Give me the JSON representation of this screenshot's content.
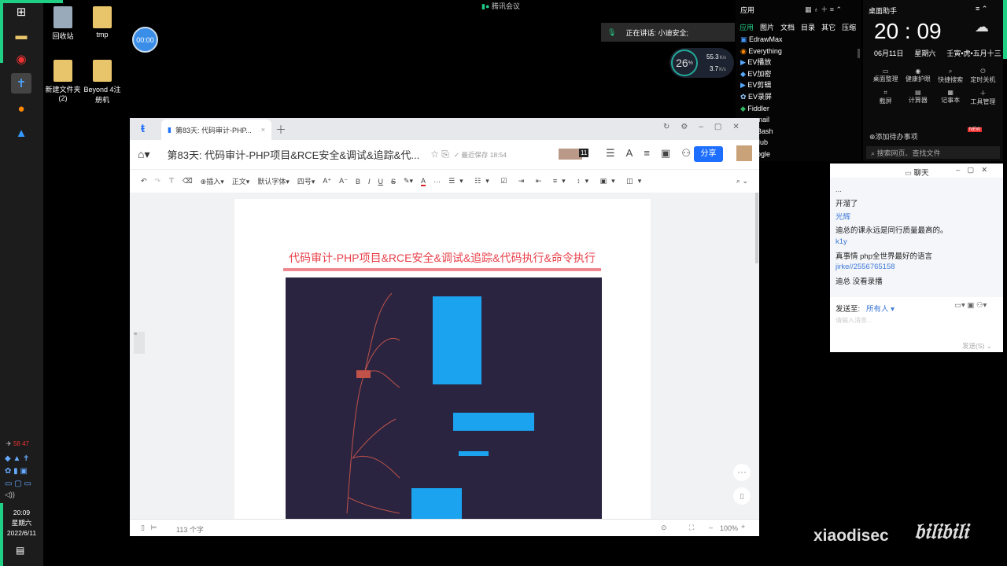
{
  "desktop": {
    "icons": [
      "回收站",
      "tmp",
      "新建文件夹\n(2)",
      "Beyond 4注\n册机"
    ],
    "timer": "00:00"
  },
  "meeting": {
    "app": "腾讯会议",
    "speaking": "正在讲话: 小迪安全;",
    "cpu": "26",
    "cpu_unit": "%",
    "up": "55.3",
    "down": "3.7",
    "rate_unit": "K/s"
  },
  "taskbar": {
    "tray_numbers": [
      "58",
      "47"
    ],
    "time": "20:09",
    "weekday": "星期六",
    "date": "2022/6/11"
  },
  "apps_panel": {
    "title": "应用",
    "tabs": [
      "应用",
      "图片",
      "文档",
      "目录",
      "其它",
      "压缩"
    ],
    "items": [
      "EdrawMax",
      "Everything",
      "EV播放",
      "EV加密",
      "EV剪辑",
      "EV录屏",
      "Fiddler",
      "xmail",
      "t Bash",
      "tHub",
      "oogle"
    ]
  },
  "helper": {
    "title": "桌面助手",
    "time": "20 : 09",
    "date": "06月11日",
    "weekday": "星期六",
    "lunar": "壬寅•虎•五月十三",
    "tools": [
      "桌面整理",
      "健康护眼",
      "快捷搜索",
      "定时关机",
      "截屏",
      "计算器",
      "记事本",
      "工具管理"
    ],
    "todo": "添加待办事项",
    "new_badge": "NEW",
    "search": "搜索网页、查找文件"
  },
  "doc": {
    "tab": "第83天: 代码审计-PHP...",
    "title": "第83天: 代码审计-PHP项目&RCE安全&调试&追踪&代...",
    "saved": "最近保存 18:54",
    "collab_count": "11",
    "share": "分享",
    "toolbar": [
      "插入",
      "正文",
      "默认字体",
      "四号",
      "A⁺",
      "A⁻",
      "B",
      "I",
      "U",
      "S",
      "A",
      "···"
    ],
    "heading": "代码审计-PHP项目&RCE安全&调试&追踪&代码执行&命令执行",
    "word_count": "113 个字",
    "zoom": "100%",
    "accent": "#e8414b"
  },
  "chat": {
    "title": "聊天",
    "messages": [
      {
        "name": "...",
        "text": "开溜了"
      },
      {
        "name": "光辉",
        "text": "迪总的课永远是同行质量最高的。"
      },
      {
        "name": "k1y",
        "text": "真事情 php全世界最好的语言"
      },
      {
        "name": "jirke//2556765158",
        "text": "迪总 没看录播"
      }
    ],
    "send_to_label": "发送至:",
    "send_to": "所有人",
    "placeholder": "请输入消息...",
    "send": "发送(S)"
  },
  "watermark": {
    "user": "xiaodisec",
    "logo": "bilibili"
  }
}
